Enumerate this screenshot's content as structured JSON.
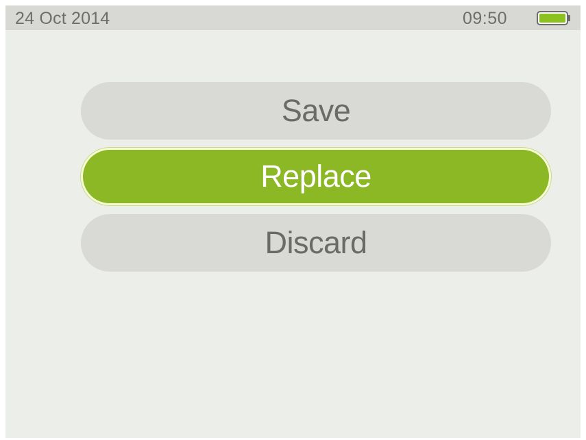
{
  "status_bar": {
    "date": "24 Oct 2014",
    "time": "09:50",
    "battery_icon": "battery-full-icon",
    "battery_color": "#8cc21f",
    "battery_level": 1.0
  },
  "menu": {
    "items": [
      {
        "label": "Save",
        "selected": false
      },
      {
        "label": "Replace",
        "selected": true
      },
      {
        "label": "Discard",
        "selected": false
      }
    ]
  },
  "colors": {
    "background": "#ebeee9",
    "status_bar": "#d8d9d4",
    "button": "#d9dad5",
    "button_text": "#6a6b66",
    "selected_button": "#8cb825",
    "selected_text": "#ffffff"
  }
}
